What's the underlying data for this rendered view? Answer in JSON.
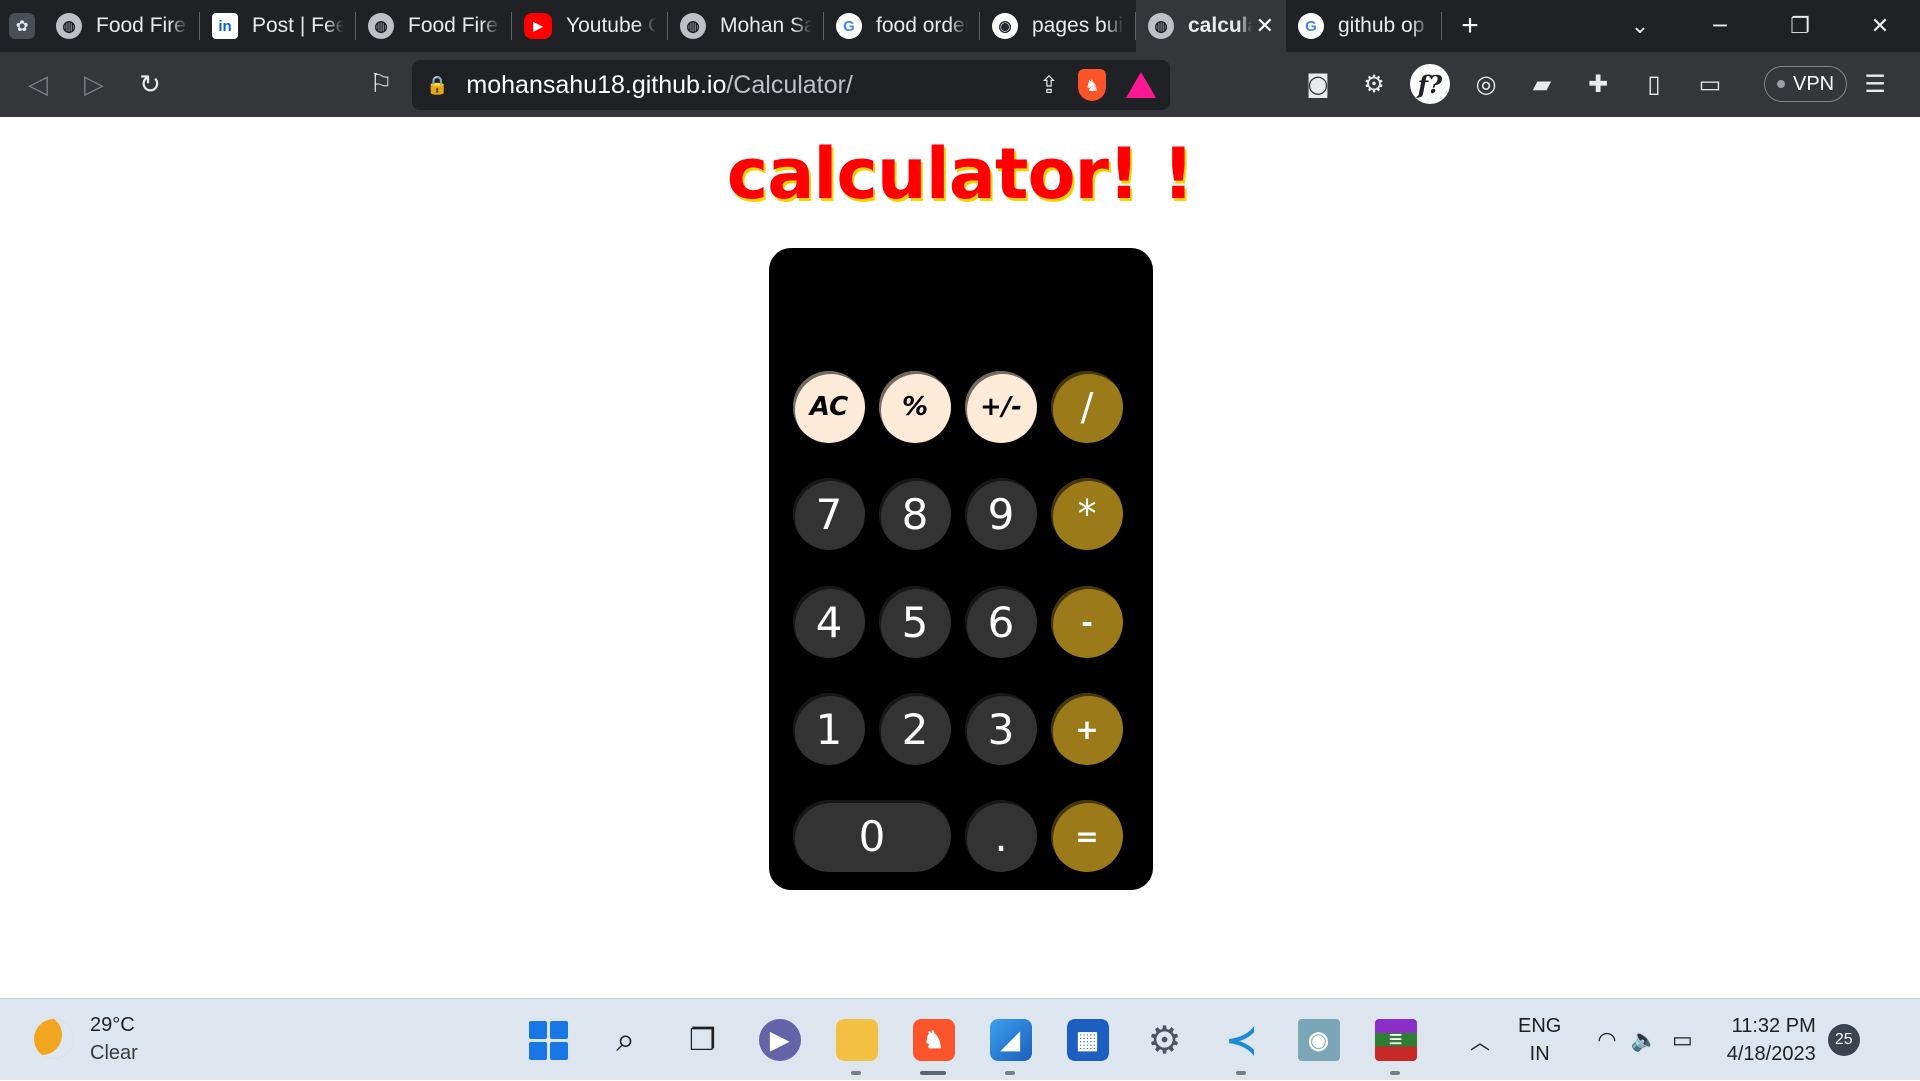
{
  "browser": {
    "tabs": [
      {
        "title": "Food Fire",
        "favicon": "globe-icon"
      },
      {
        "title": "Post | Feed",
        "favicon": "linkedin-icon"
      },
      {
        "title": "Food Fire",
        "favicon": "globe-icon"
      },
      {
        "title": "Youtube Channel",
        "favicon": "youtube-icon"
      },
      {
        "title": "Mohan Sahu",
        "favicon": "globe-icon"
      },
      {
        "title": "food order",
        "favicon": "google-icon"
      },
      {
        "title": "pages build",
        "favicon": "github-icon"
      },
      {
        "title": "calculator",
        "favicon": "globe-icon",
        "active": true
      },
      {
        "title": "github op",
        "favicon": "google-icon"
      }
    ],
    "url_host": "mohansahu18.github.io",
    "url_path": "/Calculator/",
    "vpn_label": "VPN"
  },
  "page": {
    "heading": "calculator! !",
    "display_value": ""
  },
  "calculator": {
    "keys": {
      "ac": "AC",
      "percent": "%",
      "sign": "+/-",
      "divide": "/",
      "seven": "7",
      "eight": "8",
      "nine": "9",
      "multiply": "*",
      "four": "4",
      "five": "5",
      "six": "6",
      "subtract": "-",
      "one": "1",
      "two": "2",
      "three": "3",
      "add": "+",
      "zero": "0",
      "decimal": ".",
      "equals": "="
    }
  },
  "taskbar": {
    "weather_temp": "29°C",
    "weather_condition": "Clear",
    "lang_primary": "ENG",
    "lang_secondary": "IN",
    "time": "11:32 PM",
    "date": "4/18/2023",
    "notification_count": "25"
  },
  "colors": {
    "heading": "#ff0000",
    "heading_shadow": "#f5d400",
    "calculator_body": "#000000",
    "function_key": "#fdebd7",
    "number_key": "#333333",
    "operator_key": "#9b7a1a"
  }
}
